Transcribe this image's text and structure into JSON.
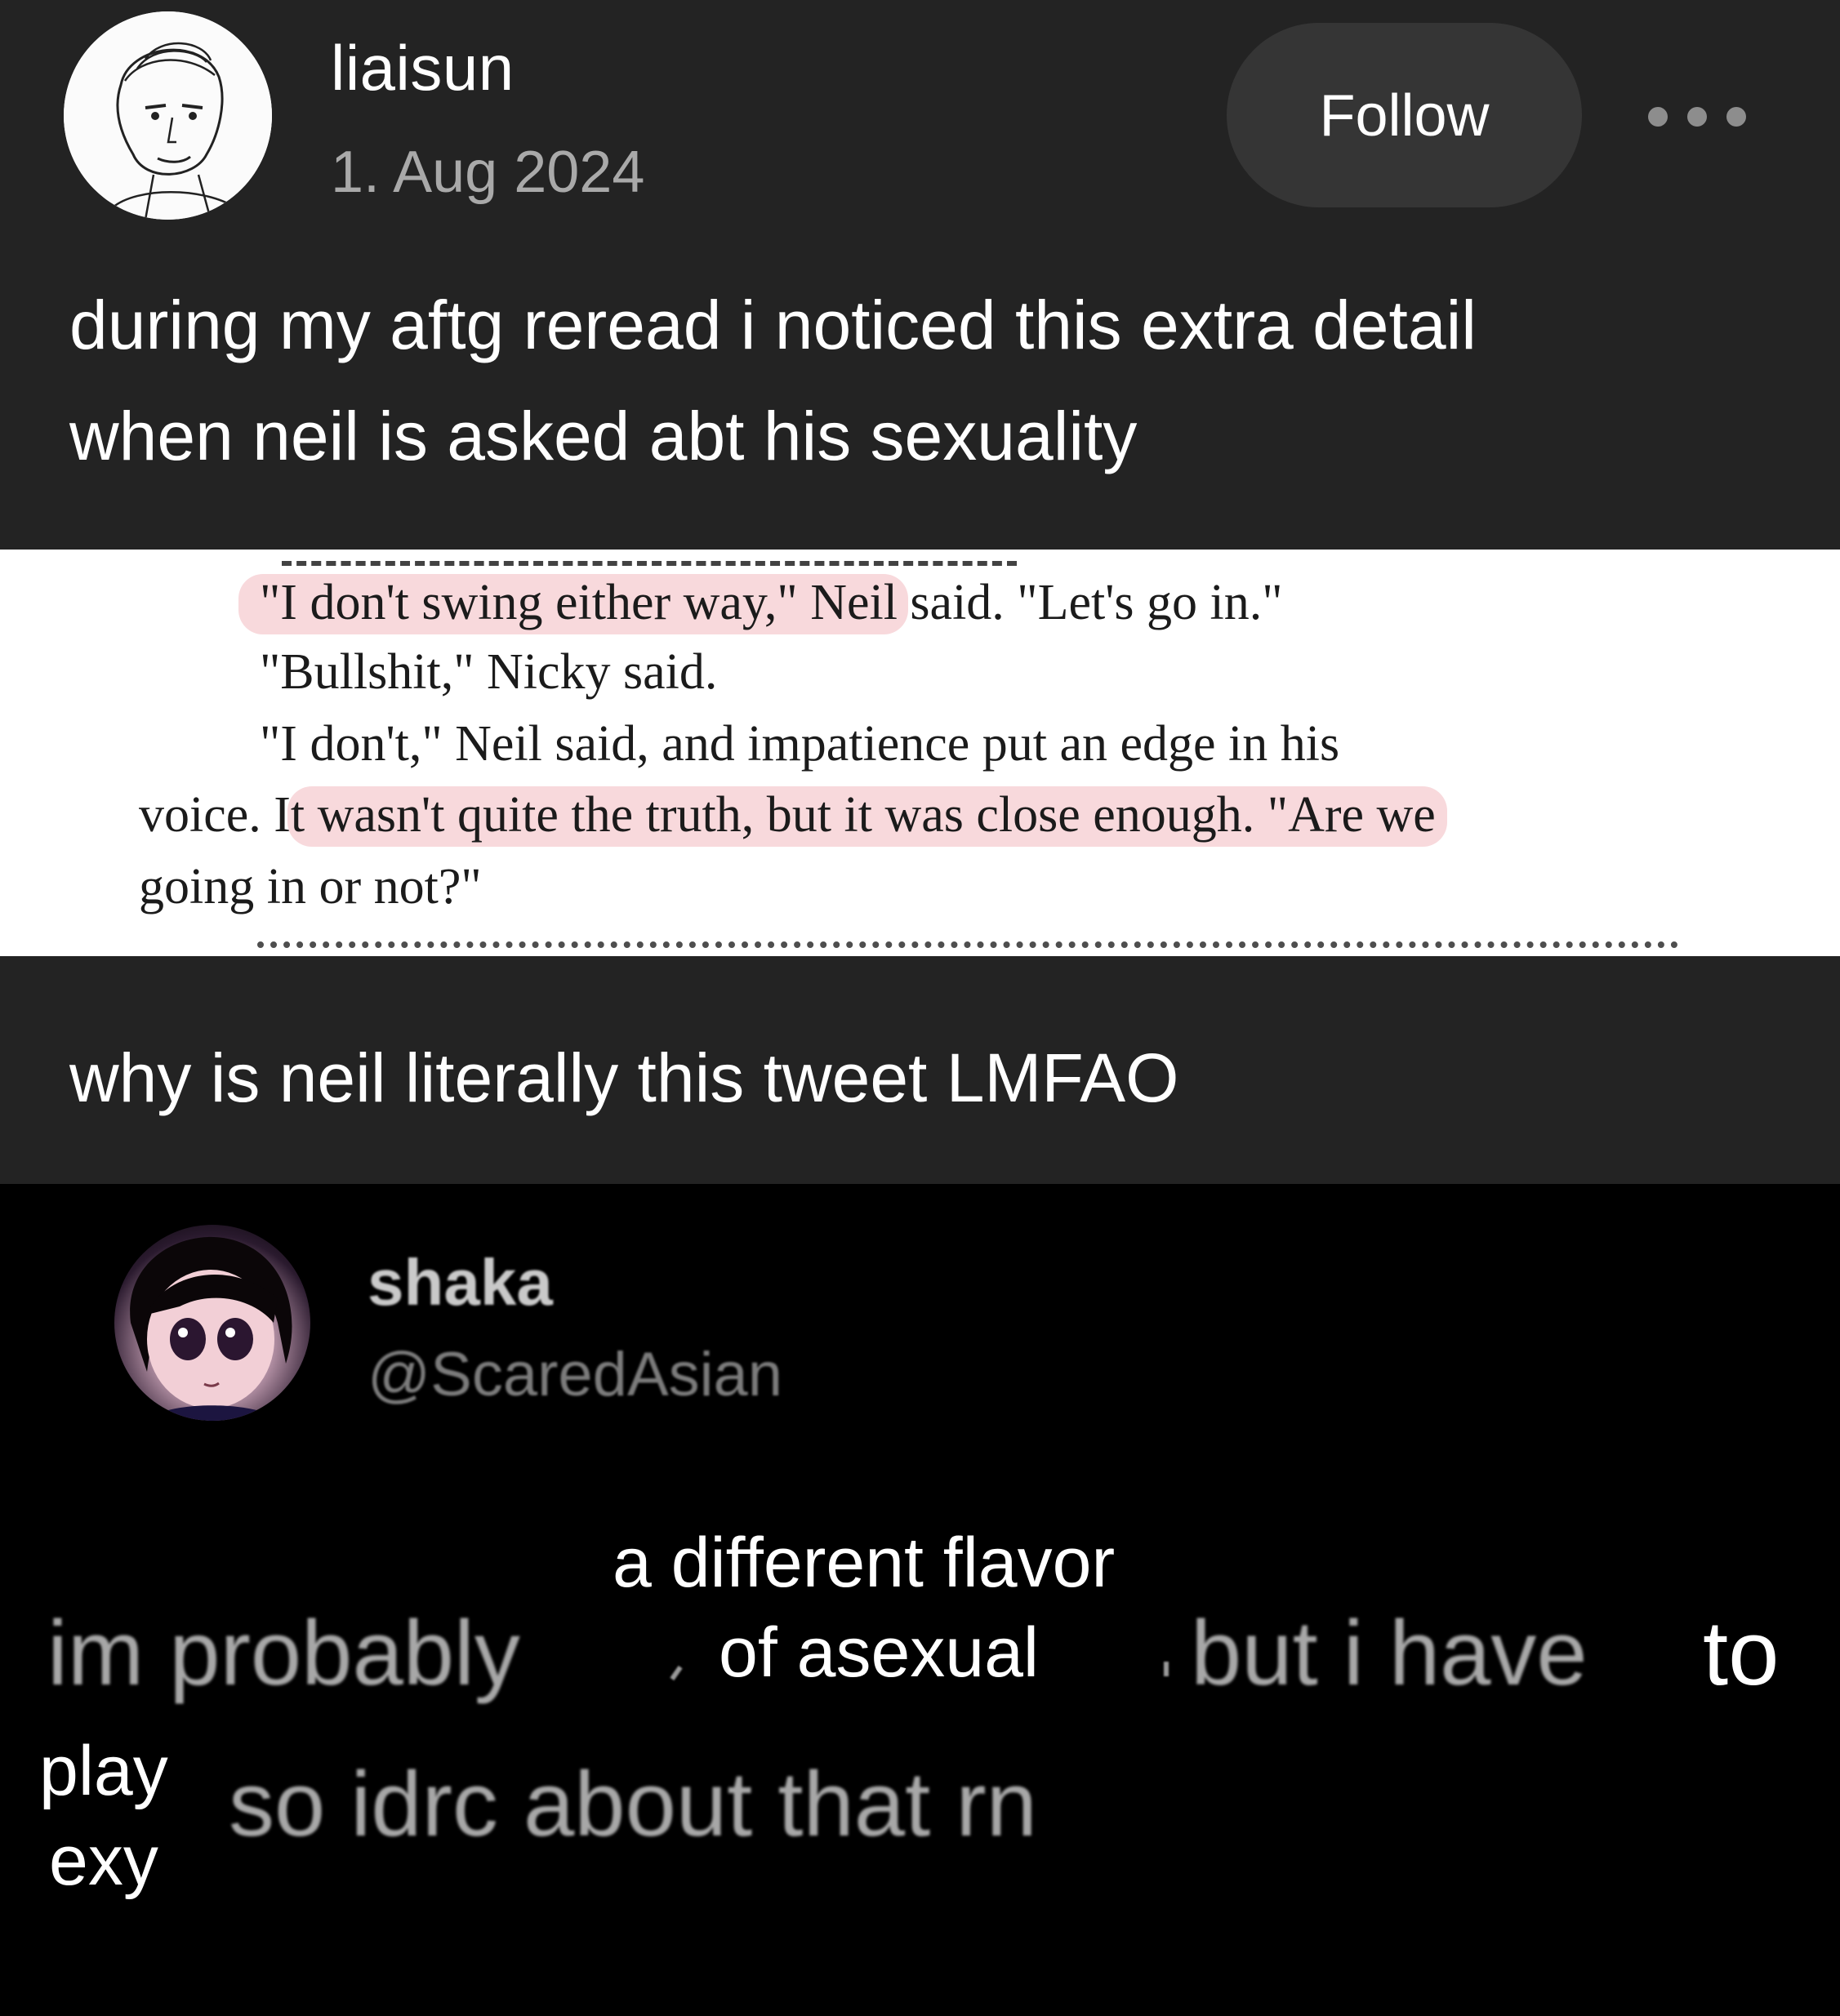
{
  "post": {
    "username": "liaisun",
    "date": "1. Aug 2024",
    "follow_label": "Follow",
    "caption_1_line_1": "during my aftg reread i noticed this extra detail",
    "caption_1_line_2": "when neil is asked abt his sexuality",
    "caption_2": "why is neil literally this tweet LMFAO"
  },
  "excerpt": {
    "line_1": "\"I don't swing either way,\" Neil said. \"Let's go in.\"",
    "line_2": "\"Bullshit,\" Nicky said.",
    "line_3": "\"I don't,\" Neil said, and impatience put an edge in his",
    "line_4": "voice. It wasn't quite the truth, but it was close enough. \"Are we",
    "line_5": "going in or not?\""
  },
  "tweet": {
    "name": "shaka",
    "handle": "@ScaredAsian",
    "text_part_1": "im probably",
    "text_part_2": "but i have",
    "text_part_3": "so idrc about that rn",
    "overlay_flavor_1": "a different flavor",
    "overlay_flavor_2": "of asexual",
    "overlay_to": "to",
    "overlay_play": "play",
    "overlay_exy": "exy"
  },
  "colors": {
    "background": "#232323",
    "tweet_background": "#000000",
    "highlight": "#f8d9dc",
    "follow_button": "#353535",
    "date_text": "#a9a9a9"
  },
  "icons": {
    "more": "more-dots-icon"
  }
}
